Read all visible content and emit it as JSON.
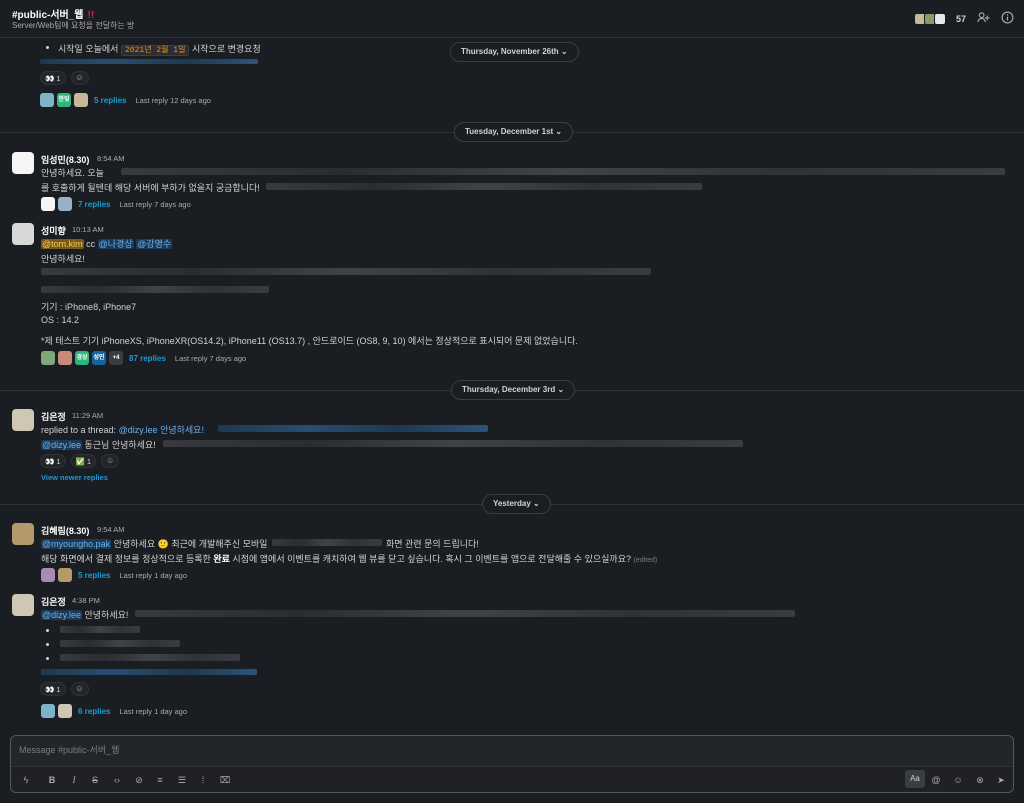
{
  "header": {
    "channel_name": "#public-서버_웹",
    "alert": "!!",
    "topic": "Server/Web팀에 요청을 전달하는 방",
    "member_count": "57"
  },
  "dates": {
    "thu_nov_26": "Thursday, November 26th",
    "tue_dec_1": "Tuesday, December 1st",
    "thu_dec_3": "Thursday, December 3rd",
    "yesterday": "Yesterday"
  },
  "chevron": "⌄",
  "msg0": {
    "bullet_prefix": "시작일 오늘에서",
    "code": "2021년 2월 1일",
    "bullet_suffix": "시작으로 변경요청",
    "reaction_eyes": "👀",
    "reaction_eyes_count": "1",
    "thread_avatar_text": "한빛",
    "replies": "5 replies",
    "last_reply": "Last reply 12 days ago"
  },
  "msg1": {
    "name": "임성민(8.30)",
    "time": "8:54 AM",
    "line1": "안녕하세요. 오늘",
    "line2": "를 호출하게 될텐데 해당 서버에 부하가 없을지 궁금합니다!",
    "replies": "7 replies",
    "last_reply": "Last reply 7 days ago"
  },
  "msg2": {
    "name": "성미향",
    "time": "10:13 AM",
    "mention1": "@tom.kim",
    "cc": "cc",
    "mention2": "@나경상",
    "mention3": "@강명수",
    "greeting": "안녕하세요!",
    "device": "기기 : iPhone8, iPhone7",
    "os": "OS : 14.2",
    "note": "*제 테스트 기기 iPhoneXS, iPhoneXR(OS14.2), iPhone11 (OS13.7) , 안드로이드 (OS8, 9, 10) 에서는 정상적으로 표시되어 문제 없었습니다.",
    "thread_av3": "경상",
    "thread_av4": "성민",
    "thread_more": "+4",
    "replies": "87 replies",
    "last_reply": "Last reply 7 days ago"
  },
  "msg3": {
    "name": "김은정",
    "time": "11:29 AM",
    "replied_to": "replied to a thread:",
    "thread_mention": "@dizy.lee 안녕하세요!",
    "mention": "@dizy.lee",
    "line2": "동근님 안녕하세요!",
    "reaction_eyes": "👀",
    "reaction_eyes_count": "1",
    "reaction_check": "✅",
    "reaction_check_count": "1",
    "view_newer": "View newer replies"
  },
  "msg4": {
    "name": "김혜림(8.30)",
    "time": "9:54 AM",
    "mention": "@myoungho.pak",
    "line1_a": "안녕하세요",
    "emoji": "🙂",
    "line1_b": "최근에 개발해주신 모바일",
    "line1_c": "화면 관련 문의 드립니다!",
    "line2_a": "해당 화면에서 결제 정보를 정상적으로 등록한",
    "line2_bold": "완료",
    "line2_b": "시점에 앱에서 이벤트를 캐치하여 웹 뷰를 닫고 싶습니다. 혹시 그 이벤트를 앱으로 전달해줄 수 있으실까요?",
    "edited": "(edited)",
    "replies": "5 replies",
    "last_reply": "Last reply 1 day ago"
  },
  "msg5": {
    "name": "김은정",
    "time": "4:38 PM",
    "mention": "@dizy.lee",
    "line1": "안녕하세요!",
    "reaction_eyes": "👀",
    "reaction_eyes_count": "1",
    "replies": "6 replies",
    "last_reply": "Last reply 1 day ago"
  },
  "composer": {
    "placeholder": "Message #public-서버_웹",
    "aa": "Aa"
  },
  "colors": {
    "link": "#1d9bd1",
    "mention_bg": "#1d3a55",
    "alert": "#e01e5a"
  }
}
